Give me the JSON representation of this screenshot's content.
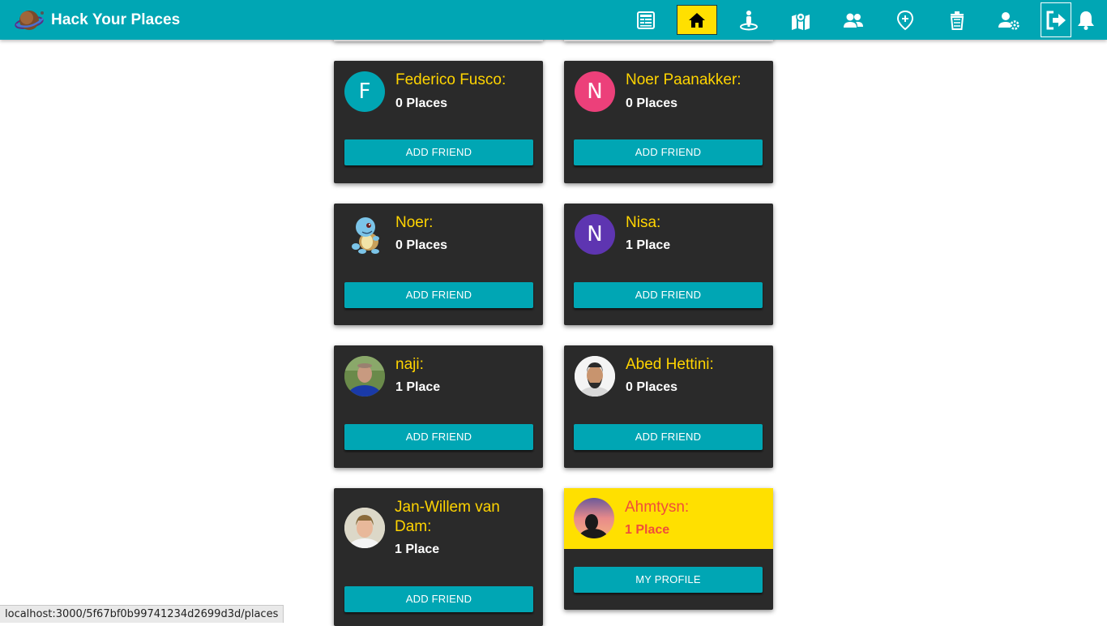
{
  "app": {
    "title": "Hack Your Places"
  },
  "nav": {
    "items": [
      {
        "name": "news-feed",
        "icon": "newspaper-icon"
      },
      {
        "name": "home",
        "icon": "home-icon",
        "active": true
      },
      {
        "name": "my-places",
        "icon": "person-on-pin-icon"
      },
      {
        "name": "map",
        "icon": "map-marker-icon"
      },
      {
        "name": "users",
        "icon": "users-icon"
      },
      {
        "name": "add-place",
        "icon": "add-location-icon"
      },
      {
        "name": "trash",
        "icon": "trash-icon"
      },
      {
        "name": "settings",
        "icon": "user-cog-icon"
      },
      {
        "name": "logout",
        "icon": "sign-out-icon"
      },
      {
        "name": "notifications",
        "icon": "bell-icon"
      }
    ]
  },
  "users": [
    {
      "name": "Federico Fusco:",
      "places": "0 Places",
      "button": "ADD FRIEND",
      "avatar_letter": "F",
      "avatar_color": "#00a6b4"
    },
    {
      "name": "Noer Paanakker:",
      "places": "0 Places",
      "button": "ADD FRIEND",
      "avatar_letter": "N",
      "avatar_color": "#ec407a"
    },
    {
      "name": "Noer:",
      "places": "0 Places",
      "button": "ADD FRIEND",
      "avatar_image": "squirtle-avatar"
    },
    {
      "name": "Nisa:",
      "places": "1 Place",
      "button": "ADD FRIEND",
      "avatar_letter": "N",
      "avatar_color": "#5e35b1"
    },
    {
      "name": "naji:",
      "places": "1 Place",
      "button": "ADD FRIEND",
      "avatar_image": "photo-avatar"
    },
    {
      "name": "Abed Hettini:",
      "places": "0 Places",
      "button": "ADD FRIEND",
      "avatar_image": "photo-avatar"
    },
    {
      "name": "Jan-Willem van Dam:",
      "places": "1 Place",
      "button": "ADD FRIEND",
      "avatar_image": "photo-avatar"
    },
    {
      "name": "Ahmtysn:",
      "places": "1 Place",
      "button": "MY PROFILE",
      "avatar_image": "sunset-silhouette-avatar",
      "is_self": true
    }
  ],
  "colors": {
    "brand": "#00a6b4",
    "accent": "#ffe000",
    "card": "#2a2a2a",
    "name": "#ffd400",
    "self_text": "#f04e3a"
  },
  "status_bar": {
    "url": "localhost:3000/5f67bf0b99741234d2699d3d/places"
  }
}
